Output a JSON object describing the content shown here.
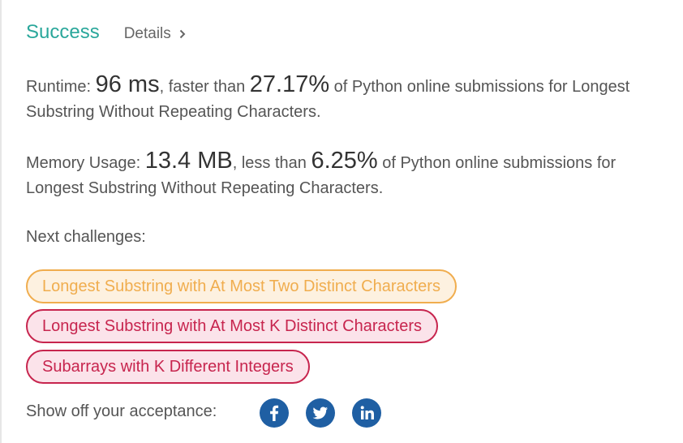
{
  "header": {
    "status": "Success",
    "details_label": "Details"
  },
  "runtime": {
    "label": "Runtime: ",
    "value": "96 ms",
    "comparison": ", faster than ",
    "percent": "27.17%",
    "tail": " of Python online submissions for Longest Substring Without Repeating Characters."
  },
  "memory": {
    "label": "Memory Usage: ",
    "value": "13.4 MB",
    "comparison": ", less than ",
    "percent": "6.25%",
    "tail": " of Python online submissions for Longest Substring Without Repeating Characters."
  },
  "next": {
    "label": "Next challenges:",
    "challenges": [
      {
        "title": "Longest Substring with At Most Two Distinct Characters",
        "difficulty_color": "#f0ad4e"
      },
      {
        "title": "Longest Substring with At Most K Distinct Characters",
        "difficulty_color": "#c7254e"
      },
      {
        "title": "Subarrays with K Different Integers",
        "difficulty_color": "#c7254e"
      }
    ]
  },
  "share": {
    "label": "Show off your acceptance:",
    "icons": [
      "facebook-icon",
      "twitter-icon",
      "linkedin-icon"
    ]
  },
  "colors": {
    "success": "#2aa79b",
    "social": "#1f5fa3"
  }
}
